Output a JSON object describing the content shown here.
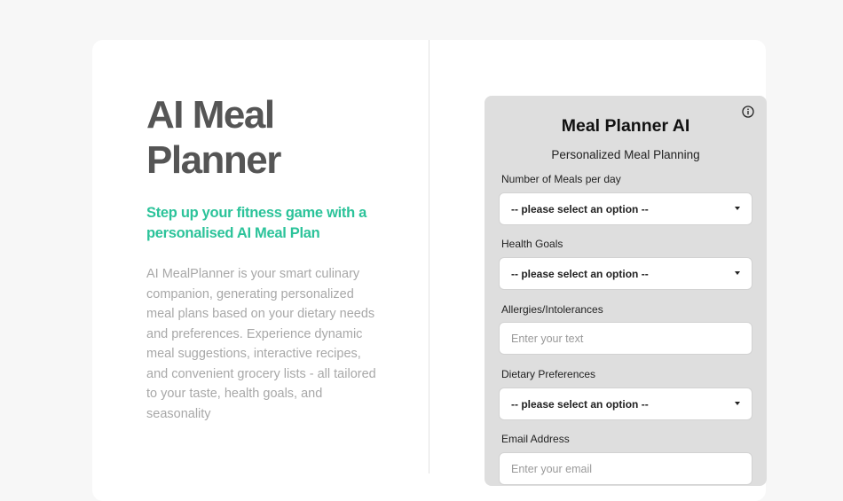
{
  "hero": {
    "title": "AI Meal Planner",
    "tagline": "Step up your fitness game with a personalised AI Meal Plan",
    "description": "AI MealPlanner is your smart culinary companion, generating personalized meal plans based on your dietary needs and preferences. Experience dynamic meal suggestions, interactive recipes, and convenient grocery lists - all tailored to your taste, health goals, and seasonality"
  },
  "form": {
    "title": "Meal Planner AI",
    "subtitle": "Personalized Meal Planning",
    "info_icon": "info-icon",
    "meals": {
      "label": "Number of Meals per day",
      "value": "-- please select an option --"
    },
    "health_goals": {
      "label": "Health Goals",
      "value": "-- please select an option --"
    },
    "allergies": {
      "label": "Allergies/Intolerances",
      "placeholder": "Enter your text"
    },
    "dietary": {
      "label": "Dietary Preferences",
      "value": "-- please select an option --"
    },
    "email": {
      "label": "Email Address",
      "placeholder": "Enter your email"
    }
  },
  "colors": {
    "accent": "#2cc39a",
    "title": "#555555",
    "panel": "#dedede",
    "background": "#f7f7f7"
  }
}
